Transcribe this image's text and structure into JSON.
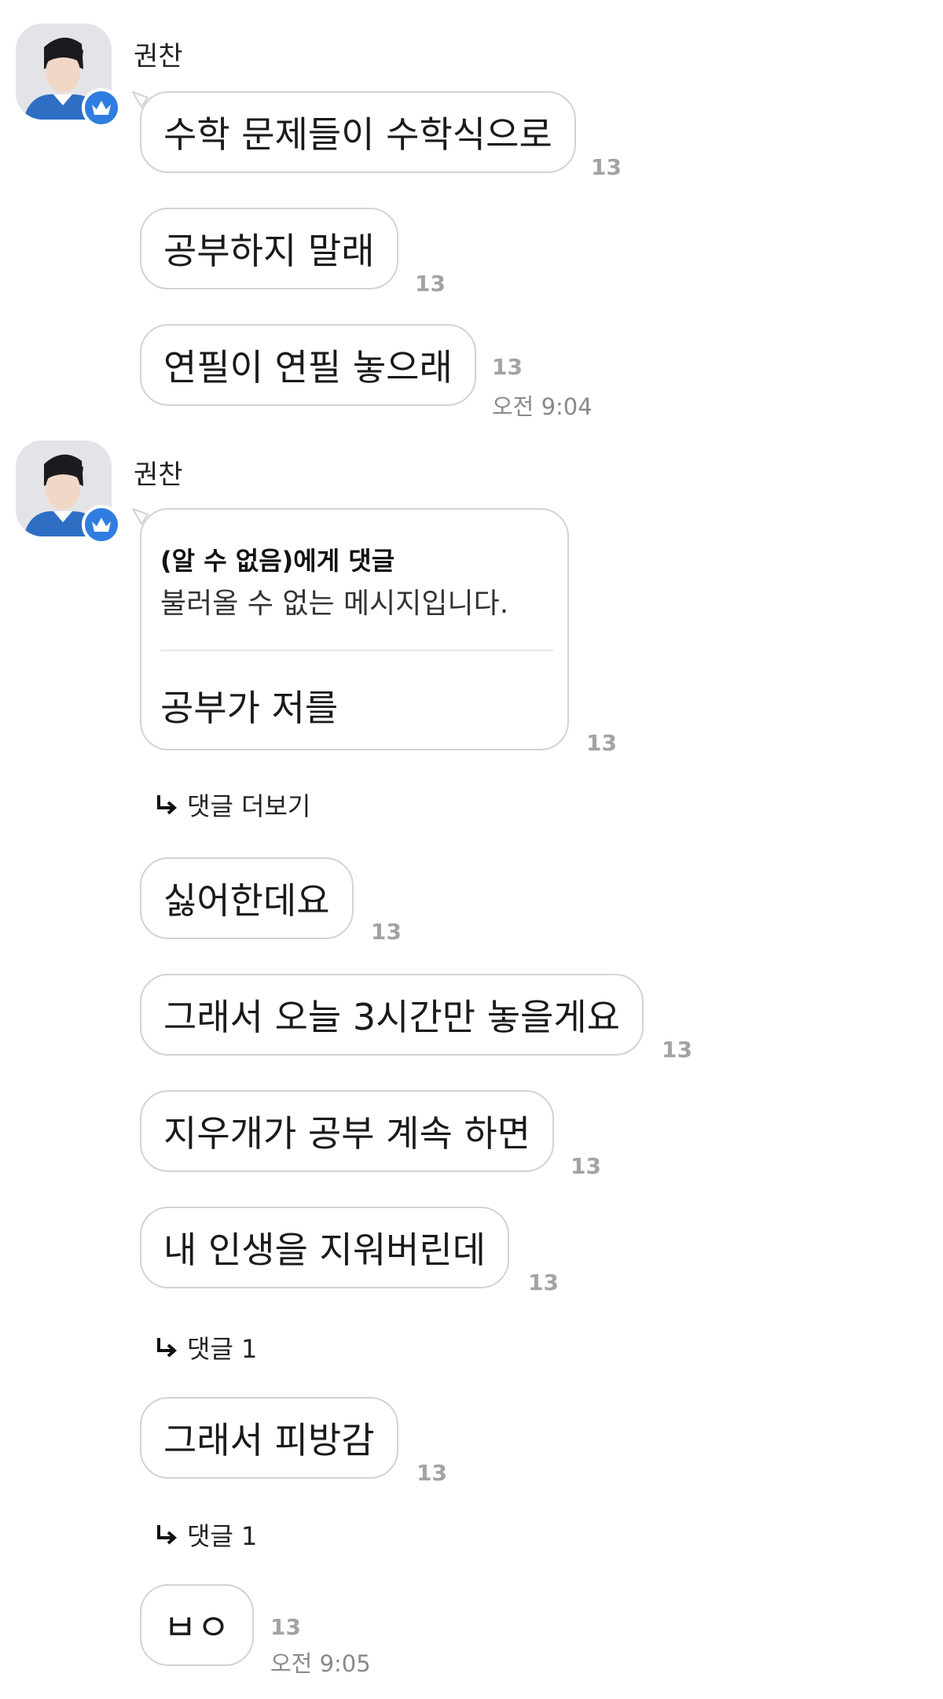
{
  "groups": [
    {
      "sender": "권찬",
      "messages": [
        {
          "text": "수학 문제들이 수학식으로",
          "count": "13"
        },
        {
          "text": "공부하지 말래",
          "count": "13"
        },
        {
          "text": "연필이 연필 놓으래",
          "count": "13",
          "time": "오전 9:04"
        }
      ]
    },
    {
      "sender": "권찬",
      "reply": {
        "to": "(알 수 없음)에게 댓글",
        "quote": "불러올 수 없는 메시지입니다.",
        "text": "공부가 저를",
        "count": "13",
        "thread_label": "댓글 더보기"
      },
      "messages": [
        {
          "text": "싫어한데요",
          "count": "13"
        },
        {
          "text": "그래서 오늘 3시간만 놓을게요",
          "count": "13"
        },
        {
          "text": "지우개가 공부 계속 하면",
          "count": "13"
        },
        {
          "text": "내 인생을 지워버린데",
          "count": "13",
          "thread_label": "댓글 1"
        },
        {
          "text": "그래서 피방감",
          "count": "13",
          "thread_label": "댓글 1"
        },
        {
          "text": "ㅂㅇ",
          "count": "13",
          "time": "오전 9:05"
        }
      ]
    }
  ],
  "icons": {
    "avatar_badge": "crown-icon",
    "thread": "reply-arrow-icon"
  },
  "colors": {
    "badge": "#2f7de1",
    "count": "#a3a3a3",
    "bubble_border": "#d3d3d3"
  }
}
